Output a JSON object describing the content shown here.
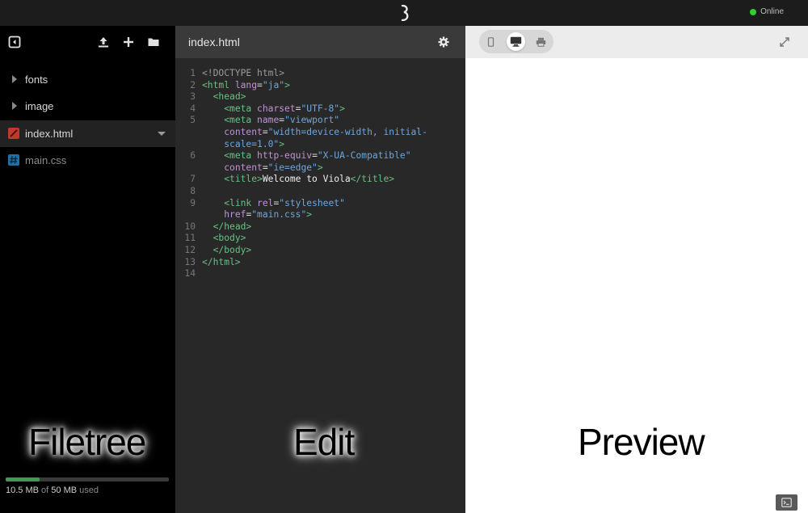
{
  "topbar": {
    "status": "Online",
    "logo_icon": "viola-logo-icon",
    "status_color": "#2fd12f"
  },
  "filetree": {
    "toolbar_icons": [
      "collapse-sidebar-icon",
      "upload-icon",
      "add-icon",
      "folder-icon"
    ],
    "items": [
      {
        "label": "fonts",
        "type": "folder"
      },
      {
        "label": "image",
        "type": "folder"
      },
      {
        "label": "index.html",
        "type": "html",
        "selected": true
      },
      {
        "label": "main.css",
        "type": "css"
      }
    ],
    "quota": {
      "used": "10.5 MB",
      "of": "of",
      "total": "50 MB",
      "suffix": "used",
      "fraction": 0.21
    }
  },
  "editor": {
    "filename": "index.html",
    "settings_icon": "gear-icon",
    "line_numbers": [
      "1",
      "2",
      "3",
      "4",
      "5",
      "",
      "",
      "6",
      "",
      "7",
      "8",
      "9",
      "",
      "10",
      "11",
      "12",
      "13",
      "14"
    ]
  },
  "preview": {
    "devices": [
      "mobile-icon",
      "desktop-icon",
      "print-icon"
    ],
    "active_device": "desktop-icon",
    "expand_icon": "expand-icon",
    "console_icon": "console-icon"
  },
  "overlay_labels": {
    "filetree": "Filetree",
    "edit": "Edit",
    "preview": "Preview"
  },
  "colors": {
    "accent_green": "#3e9a4c",
    "html_icon": "#c0392b",
    "css_icon": "#1f6fa8"
  }
}
